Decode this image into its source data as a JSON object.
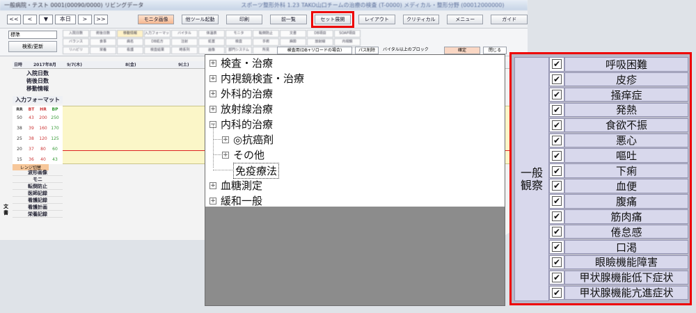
{
  "window": {
    "title": "一般病院・テスト 0001(00090/0000) リビングデータ",
    "title2": "スポーツ整形外科 1.23 TAKO山口チームの治療の検査 (T-0000) メディカル・整形分野 (00012000000)"
  },
  "toolbar": {
    "nav": [
      "<<",
      "<",
      "▼",
      "本日",
      ">",
      ">>"
    ],
    "buttons": [
      "モニタ画像",
      "他ツール起動",
      "印刷",
      "前一覧",
      "セット展開",
      "レイアウト",
      "クリティカル",
      "メニュー",
      "ガイド"
    ]
  },
  "options": {
    "select": "標準",
    "search_button": "検索/更新",
    "grid": [
      "入院日数",
      "術後日数",
      "移動情報",
      "入力フォーマット",
      "バイタル",
      "体温表",
      "モニタ",
      "転倒防止",
      "文書",
      "DB項目",
      "SOAP項目",
      "バランス",
      "食事",
      "病名",
      "DB処方",
      "注射",
      "処置",
      "検査",
      "手術",
      "麻酔",
      "放射線",
      "内視鏡",
      "リハビリ",
      "栄養",
      "看護",
      "検査結果",
      "時系列",
      "画像",
      "部門システム",
      "所見",
      "経過表",
      "サマリ",
      "オーダ",
      "指示",
      "輸血",
      "酸素",
      "ドレーン"
    ],
    "combo": "検査用(DB+リロードの場合)",
    "right_btn1": "パス削除",
    "check_label": "バイタル以上のブロック",
    "confirm": "確定",
    "close": "閉じる"
  },
  "chart": {
    "date_header": "日時",
    "month": "2017年8月",
    "days": [
      "9/7(木)",
      "8(金)",
      "9(土)"
    ],
    "rows": [
      "入院日数",
      "術後日数",
      "移動情報",
      "入力フォーマット"
    ],
    "vital_heads": [
      "RR",
      "BT",
      "HR",
      "BP"
    ],
    "vital_scales": [
      [
        "50",
        "43",
        "200",
        "250"
      ],
      [
        "38",
        "39",
        "160",
        "170"
      ],
      [
        "25",
        "38",
        "120",
        "125"
      ],
      [
        "20",
        "37",
        "80",
        "60"
      ],
      [
        "15",
        "36",
        "40",
        "43"
      ]
    ],
    "vital_footer": "レンジ切替",
    "sidebar": [
      "波形画像",
      "モニ",
      "転倒防止",
      "医師記録",
      "看護記録",
      "看護計画",
      "栄養記録"
    ],
    "doc_label": "文書"
  },
  "tree": {
    "items": [
      {
        "label": "検査・治療",
        "box": "+"
      },
      {
        "label": "内視鏡検査・治療",
        "box": "+"
      },
      {
        "label": "外科的治療",
        "box": "+"
      },
      {
        "label": "放射線治療",
        "box": "+"
      },
      {
        "label": "内科的治療",
        "box": "−"
      },
      {
        "label": "◎抗癌剤",
        "box": "+"
      },
      {
        "label": "その他",
        "box": "+"
      },
      {
        "label": "免疫療法",
        "box": ""
      },
      {
        "label": "血糖測定",
        "box": "+"
      },
      {
        "label": "緩和一般",
        "box": "+"
      }
    ]
  },
  "panel": {
    "group": "一般\n観察",
    "items": [
      "呼吸困難",
      "皮疹",
      "掻痒症",
      "発熱",
      "食欲不振",
      "悪心",
      "嘔吐",
      "下痢",
      "血便",
      "腹痛",
      "筋肉痛",
      "倦怠感",
      "口渇",
      "眼瞼機能障害",
      "甲状腺機能低下症状",
      "甲状腺機能亢進症状"
    ],
    "check": "✔"
  },
  "colors": {
    "highlight": "#e00000",
    "vital_bg": "#fbf6c8",
    "panel_bg": "#d8d8ec"
  }
}
